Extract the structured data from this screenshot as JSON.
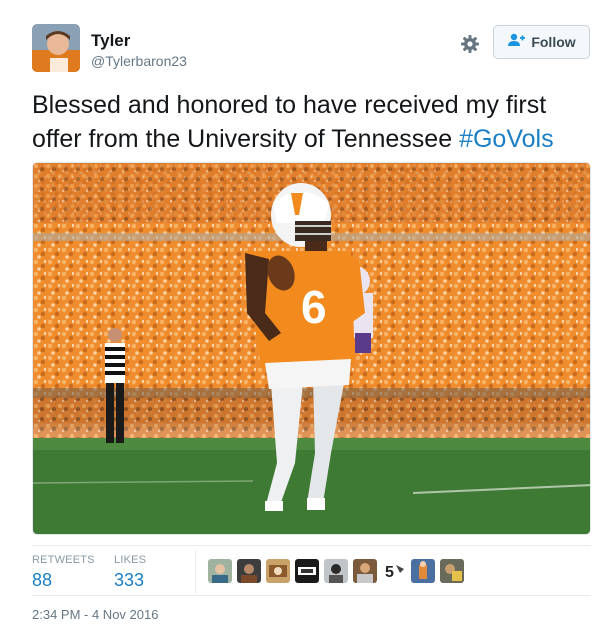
{
  "user": {
    "name": "Tyler",
    "handle": "@Tylerbaron23"
  },
  "header": {
    "follow_label": "Follow",
    "gear_icon": "gear-icon",
    "follow_icon": "person-plus-icon"
  },
  "tweet": {
    "text": "Blessed and honored to have received my first offer from the University of Tennessee ",
    "hashtag": "#GoVols"
  },
  "stats": {
    "retweets_label": "RETWEETS",
    "retweets_count": "88",
    "likes_label": "LIKES",
    "likes_count": "333"
  },
  "timestamp": "2:34 PM - 4 Nov 2016",
  "colors": {
    "link": "#1b7fc5",
    "muted": "#657786",
    "tennessee_orange": "#f0821e"
  }
}
